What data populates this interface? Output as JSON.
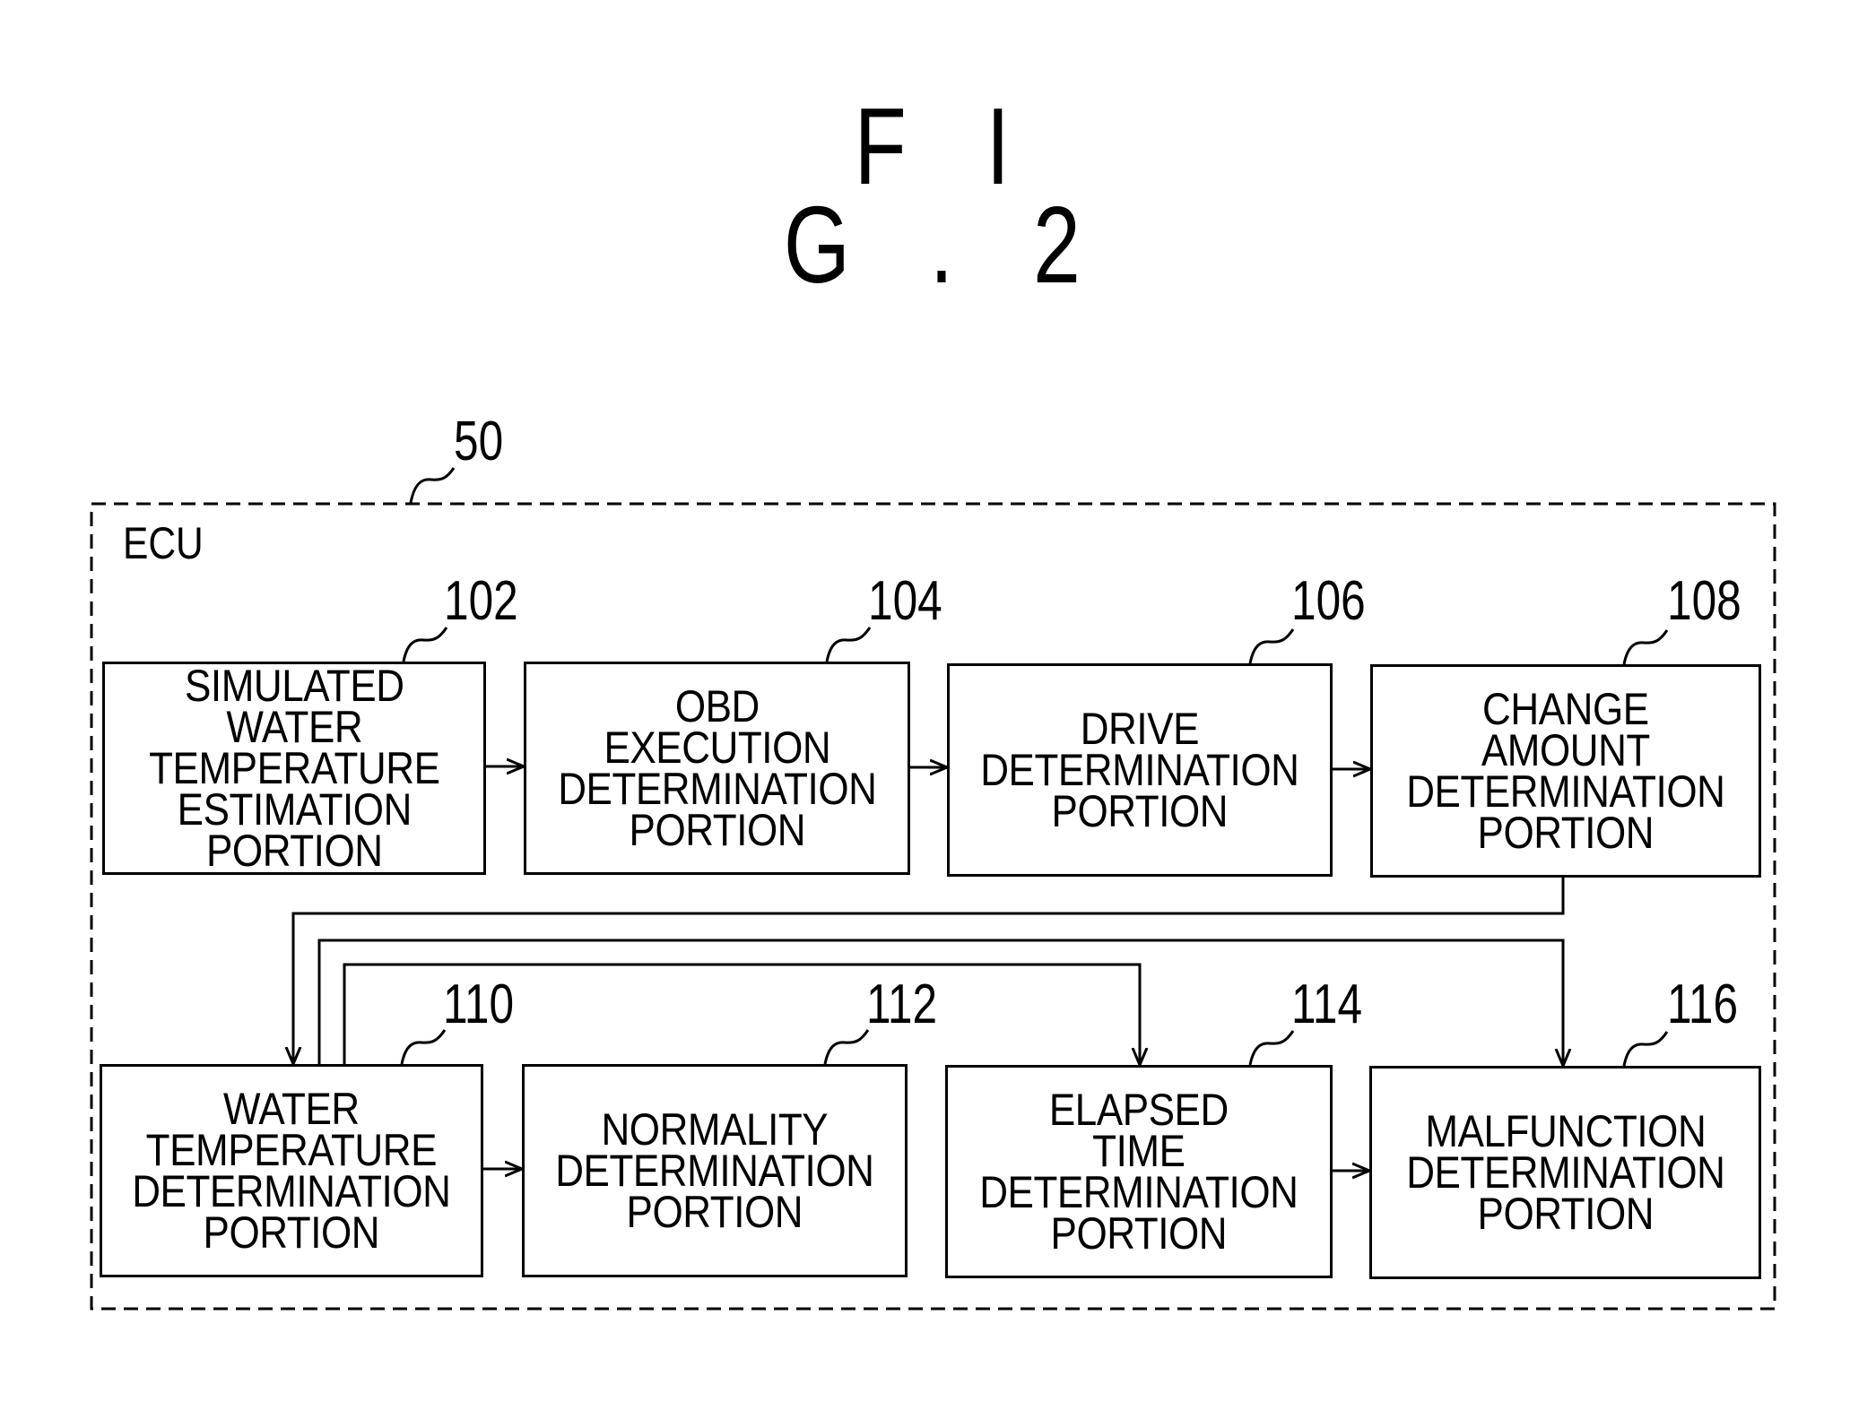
{
  "figure": {
    "title": "F I G . 2"
  },
  "ecu": {
    "reference": "50",
    "label": "ECU"
  },
  "blocks": {
    "b102": {
      "ref": "102",
      "label": "SIMULATED\nWATER\nTEMPERATURE\nESTIMATION\nPORTION"
    },
    "b104": {
      "ref": "104",
      "label": "OBD\nEXECUTION\nDETERMINATION\nPORTION"
    },
    "b106": {
      "ref": "106",
      "label": "DRIVE\nDETERMINATION\nPORTION"
    },
    "b108": {
      "ref": "108",
      "label": "CHANGE\nAMOUNT\nDETERMINATION\nPORTION"
    },
    "b110": {
      "ref": "110",
      "label": "WATER\nTEMPERATURE\nDETERMINATION\nPORTION"
    },
    "b112": {
      "ref": "112",
      "label": "NORMALITY\nDETERMINATION\nPORTION"
    },
    "b114": {
      "ref": "114",
      "label": "ELAPSED\nTIME\nDETERMINATION\nPORTION"
    },
    "b116": {
      "ref": "116",
      "label": "MALFUNCTION\nDETERMINATION\nPORTION"
    }
  },
  "connections": [
    {
      "from": "102",
      "to": "104"
    },
    {
      "from": "104",
      "to": "106"
    },
    {
      "from": "106",
      "to": "108"
    },
    {
      "from": "108",
      "to": "110"
    },
    {
      "from": "110",
      "to": "112"
    },
    {
      "from": "110",
      "to": "114"
    },
    {
      "from": "110",
      "to": "116"
    },
    {
      "from": "114",
      "to": "116"
    }
  ]
}
